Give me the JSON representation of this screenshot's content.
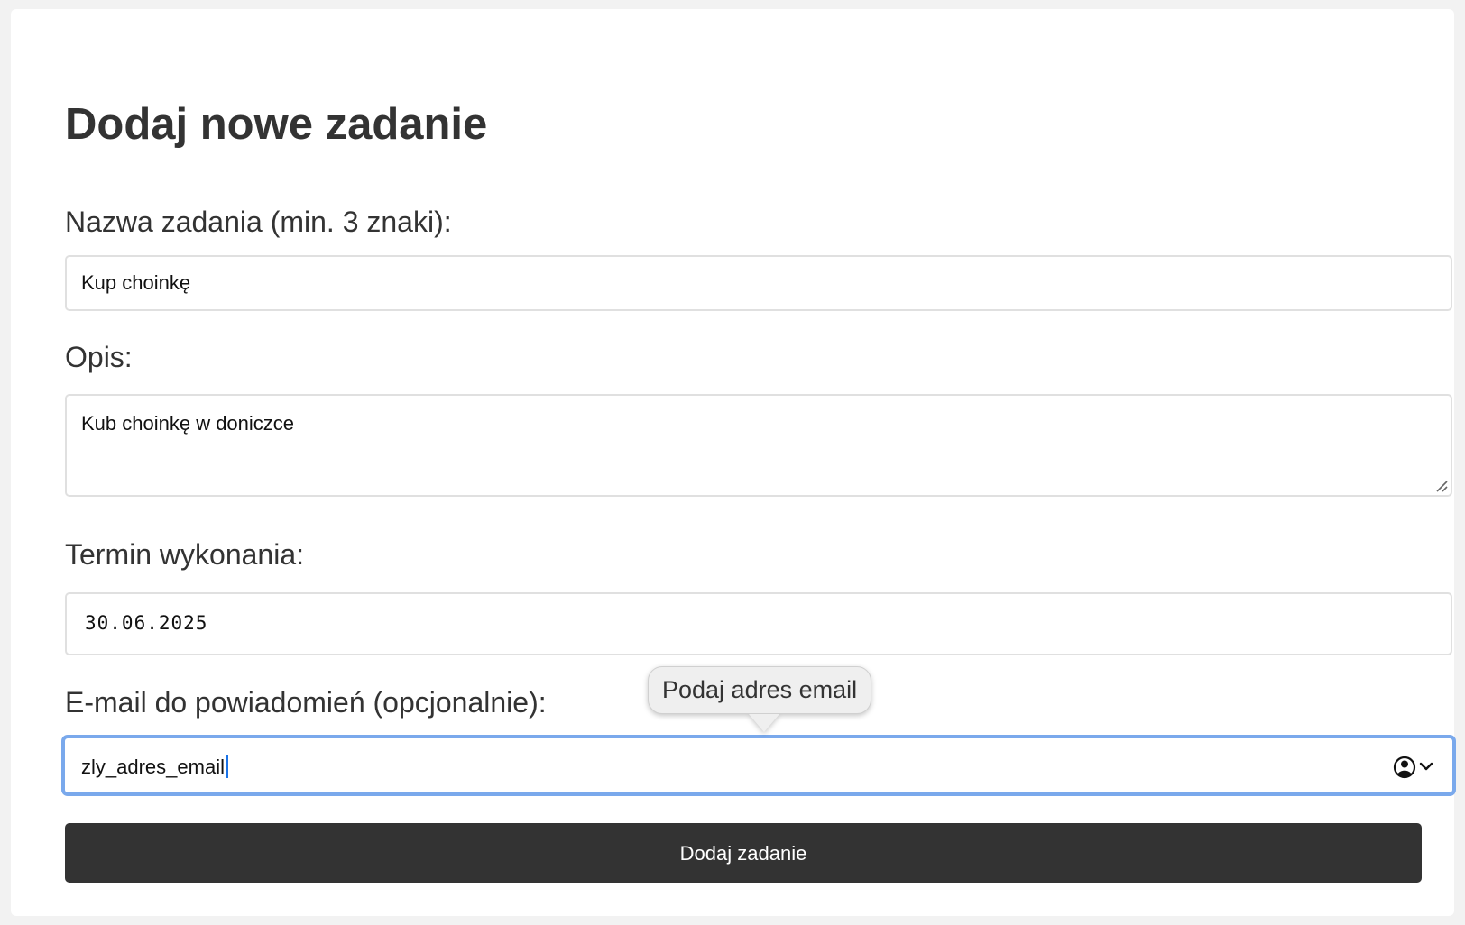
{
  "form": {
    "title": "Dodaj nowe zadanie",
    "name_label": "Nazwa zadania (min. 3 znaki):",
    "name_value": "Kup choinkę",
    "description_label": "Opis:",
    "description_value": "Kub choinkę w doniczce",
    "due_date_label": "Termin wykonania:",
    "due_date_value": "30.06.2025",
    "email_label": "E-mail do powiadomień (opcjonalnie):",
    "email_value": "zly_adres_email",
    "email_tooltip": "Podaj adres email",
    "submit_label": "Dodaj zadanie"
  },
  "icons": {
    "autofill": "contact-autofill-icon",
    "resize": "resize-handle-icon"
  },
  "colors": {
    "button_bg": "#333333",
    "focus_ring": "#7aa9ec",
    "caret": "#1a73e8"
  }
}
